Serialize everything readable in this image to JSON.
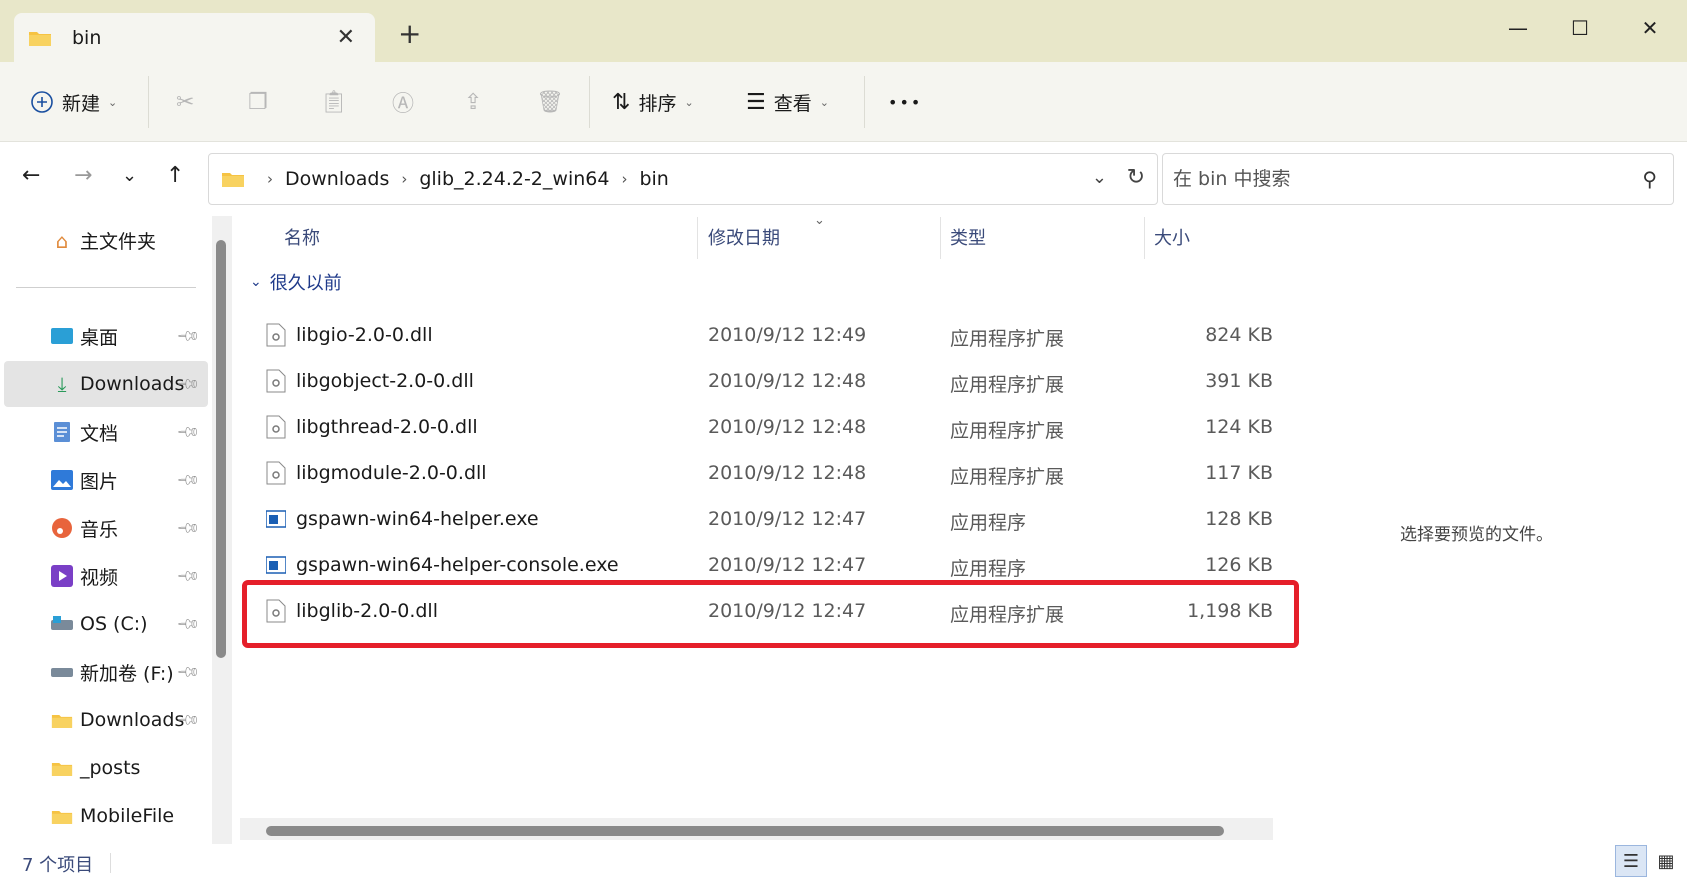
{
  "window": {
    "tab_title": "bin",
    "new_tab": "+",
    "minimize": "—",
    "maximize": "☐",
    "close": "✕"
  },
  "toolbar": {
    "new_label": "新建",
    "sort_label": "排序",
    "view_label": "查看",
    "more": "•••",
    "icons": [
      "cut-icon",
      "copy-icon",
      "paste-icon",
      "rename-icon",
      "share-icon",
      "delete-icon"
    ]
  },
  "nav": {
    "breadcrumbs": [
      "Downloads",
      "glib_2.24.2-2_win64",
      "bin"
    ],
    "search_placeholder": "在 bin 中搜索"
  },
  "sidebar": {
    "home_label": "主文件夹",
    "items": [
      {
        "label": "桌面",
        "icon": "desktop-icon",
        "pinned": true,
        "selected": false
      },
      {
        "label": "Downloads",
        "icon": "downloads-icon",
        "pinned": true,
        "selected": true
      },
      {
        "label": "文档",
        "icon": "documents-icon",
        "pinned": true,
        "selected": false
      },
      {
        "label": "图片",
        "icon": "pictures-icon",
        "pinned": true,
        "selected": false
      },
      {
        "label": "音乐",
        "icon": "music-icon",
        "pinned": true,
        "selected": false
      },
      {
        "label": "视频",
        "icon": "videos-icon",
        "pinned": true,
        "selected": false
      },
      {
        "label": "OS (C:)",
        "icon": "drive-icon",
        "pinned": true,
        "selected": false
      },
      {
        "label": "新加卷 (F:)",
        "icon": "drive-icon",
        "pinned": true,
        "selected": false
      },
      {
        "label": "Downloads",
        "icon": "folder-icon",
        "pinned": true,
        "selected": false
      },
      {
        "label": "_posts",
        "icon": "folder-icon",
        "pinned": false,
        "selected": false
      },
      {
        "label": "MobileFile",
        "icon": "folder-icon",
        "pinned": false,
        "selected": false
      }
    ]
  },
  "filelist": {
    "columns": {
      "name": "名称",
      "date": "修改日期",
      "type": "类型",
      "size": "大小"
    },
    "group": "很久以前",
    "rows": [
      {
        "name": "libgio-2.0-0.dll",
        "date": "2010/9/12 12:49",
        "type": "应用程序扩展",
        "size": "824 KB",
        "kind": "dll"
      },
      {
        "name": "libgobject-2.0-0.dll",
        "date": "2010/9/12 12:48",
        "type": "应用程序扩展",
        "size": "391 KB",
        "kind": "dll"
      },
      {
        "name": "libgthread-2.0-0.dll",
        "date": "2010/9/12 12:48",
        "type": "应用程序扩展",
        "size": "124 KB",
        "kind": "dll"
      },
      {
        "name": "libgmodule-2.0-0.dll",
        "date": "2010/9/12 12:48",
        "type": "应用程序扩展",
        "size": "117 KB",
        "kind": "dll"
      },
      {
        "name": "gspawn-win64-helper.exe",
        "date": "2010/9/12 12:47",
        "type": "应用程序",
        "size": "128 KB",
        "kind": "exe"
      },
      {
        "name": "gspawn-win64-helper-console.exe",
        "date": "2010/9/12 12:47",
        "type": "应用程序",
        "size": "126 KB",
        "kind": "exe"
      },
      {
        "name": "libglib-2.0-0.dll",
        "date": "2010/9/12 12:47",
        "type": "应用程序扩展",
        "size": "1,198 KB",
        "kind": "dll"
      }
    ]
  },
  "preview": {
    "empty_text": "选择要预览的文件。"
  },
  "status": {
    "item_count": "7 个项目"
  },
  "colors": {
    "titlebar": "#e8e7c9",
    "toolbar": "#f5f5f0",
    "highlight": "#e51f2a",
    "link": "#1f3a8a"
  }
}
